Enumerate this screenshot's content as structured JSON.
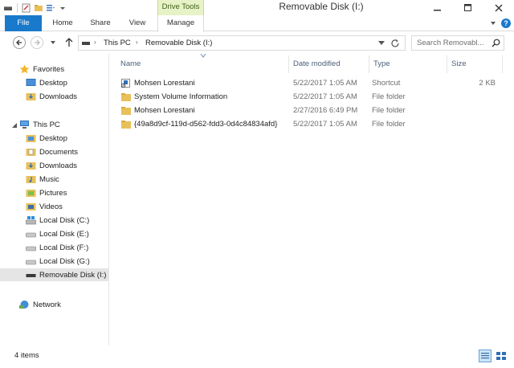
{
  "window": {
    "title": "Removable Disk (I:)",
    "context_tab_group": "Drive Tools"
  },
  "ribbon": {
    "tabs": [
      {
        "label": "File",
        "active": false
      },
      {
        "label": "Home",
        "active": false
      },
      {
        "label": "Share",
        "active": false
      },
      {
        "label": "View",
        "active": false
      },
      {
        "label": "Manage",
        "active": true
      }
    ],
    "help_label": "?"
  },
  "address_bar": {
    "breadcrumbs": [
      "This PC",
      "Removable Disk (I:)"
    ],
    "separator": "›"
  },
  "search": {
    "placeholder": "Search Removabl..."
  },
  "nav_pane": {
    "favorites": {
      "label": "Favorites",
      "items": [
        "Desktop",
        "Downloads"
      ]
    },
    "this_pc": {
      "label": "This PC",
      "items": [
        "Desktop",
        "Documents",
        "Downloads",
        "Music",
        "Pictures",
        "Videos",
        "Local Disk (C:)",
        "Local Disk (E:)",
        "Local Disk (F:)",
        "Local Disk (G:)",
        "Removable Disk (I:)"
      ],
      "selected": "Removable Disk (I:)"
    },
    "network": {
      "label": "Network"
    }
  },
  "file_list": {
    "columns": [
      "Name",
      "Date modified",
      "Type",
      "Size"
    ],
    "rows": [
      {
        "name": "Mohsen Lorestani",
        "date": "5/22/2017 1:05 AM",
        "type": "Shortcut",
        "size": "2 KB",
        "icon": "shortcut-icon"
      },
      {
        "name": "System Volume Information",
        "date": "5/22/2017 1:05 AM",
        "type": "File folder",
        "size": "",
        "icon": "folder-icon"
      },
      {
        "name": "Mohsen Lorestani",
        "date": "2/27/2016 6:49 PM",
        "type": "File folder",
        "size": "",
        "icon": "folder-icon"
      },
      {
        "name": "{49a8d9cf-119d-d562-fdd3-0d4c84834afd}",
        "date": "5/22/2017 1:05 AM",
        "type": "File folder",
        "size": "",
        "icon": "folder-icon"
      }
    ]
  },
  "status_bar": {
    "item_count": "4 items"
  },
  "colors": {
    "accent": "#1979ca",
    "context_tab": "#e7f2c6",
    "selection": "#e5e5e5",
    "folder": "#e8c05a"
  }
}
